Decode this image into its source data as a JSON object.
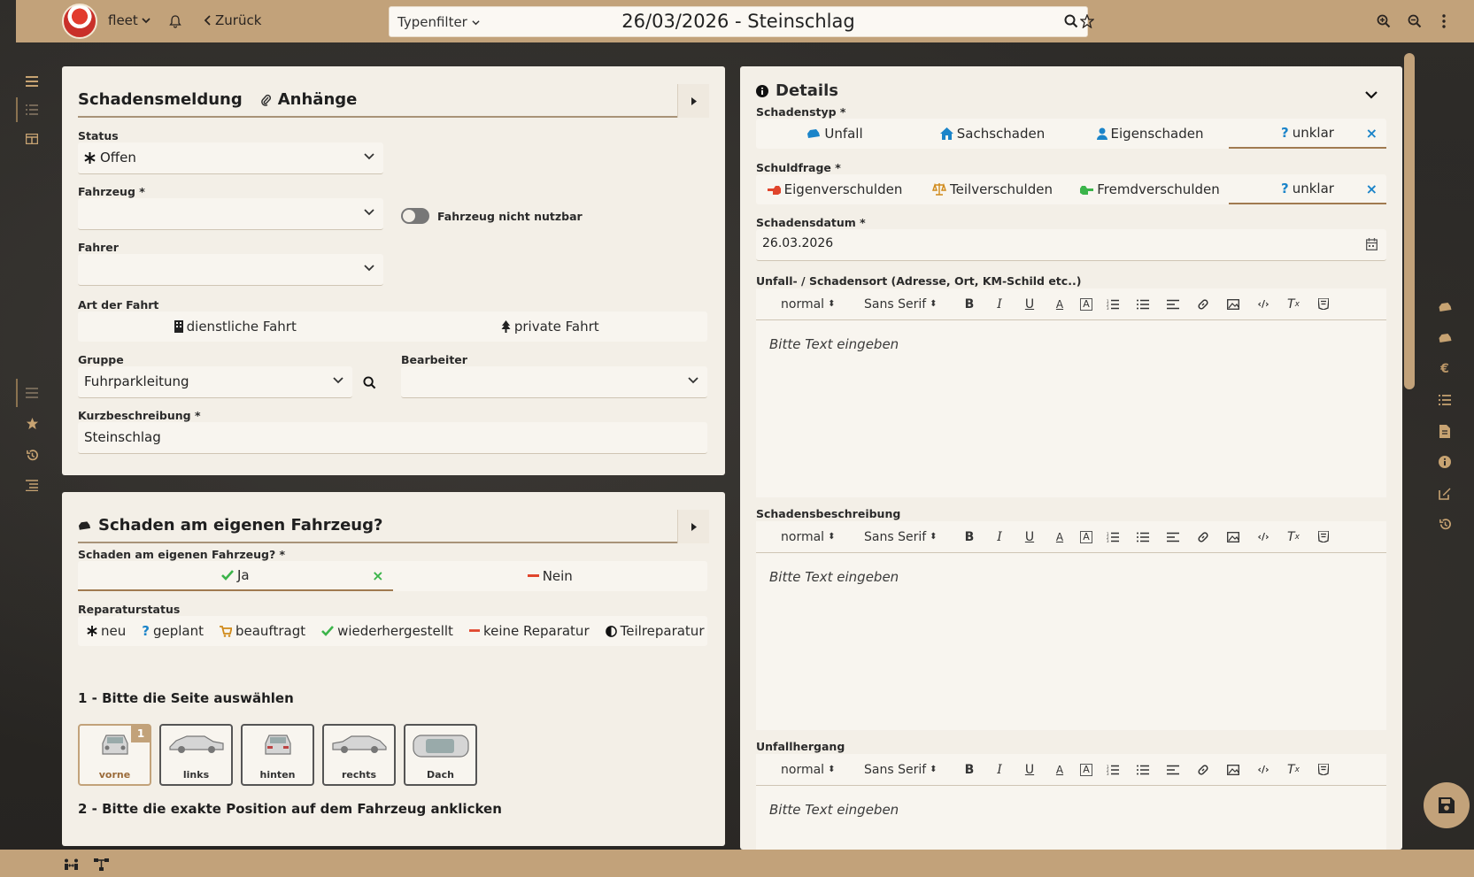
{
  "topbar": {
    "app_label": "fleet",
    "back_label": "Zurück",
    "filter_label": "Typenfilter",
    "record_title": "26/03/2026 - Steinschlag"
  },
  "card_damage": {
    "title": "Schadensmeldung",
    "attachments_label": "Anhänge",
    "status_label": "Status",
    "status_value": "Offen",
    "vehicle_label": "Fahrzeug *",
    "vehicle_value": "",
    "vehicle_unusable_label": "Fahrzeug nicht nutzbar",
    "driver_label": "Fahrer",
    "driver_value": "",
    "trip_type_label": "Art der Fahrt",
    "trip_types": [
      "dienstliche Fahrt",
      "private Fahrt"
    ],
    "group_label": "Gruppe",
    "group_value": "Fuhrparkleitung",
    "editor_label": "Bearbeiter",
    "editor_value": "",
    "short_desc_label": "Kurzbeschreibung *",
    "short_desc_value": "Steinschlag"
  },
  "card_own_vehicle": {
    "title": "Schaden am eigenen Fahrzeug?",
    "question_label": "Schaden am eigenen Fahrzeug? *",
    "yes_label": "Ja",
    "no_label": "Nein",
    "repair_status_label": "Reparaturstatus",
    "repair_status": [
      "neu",
      "geplant",
      "beauftragt",
      "wiederhergestellt",
      "keine Reparatur",
      "Teilreparatur"
    ],
    "step1_label": "1 - Bitte die Seite auswählen",
    "sides": [
      {
        "label": "vorne",
        "badge": "1"
      },
      {
        "label": "links",
        "badge": ""
      },
      {
        "label": "hinten",
        "badge": ""
      },
      {
        "label": "rechts",
        "badge": ""
      },
      {
        "label": "Dach",
        "badge": ""
      }
    ],
    "step2_label": "2 - Bitte die exakte Position auf dem Fahrzeug anklicken"
  },
  "card_details": {
    "title": "Details",
    "damage_type_label": "Schadenstyp *",
    "damage_types": [
      "Unfall",
      "Sachschaden",
      "Eigenschaden",
      "unklar"
    ],
    "fault_label": "Schuldfrage *",
    "fault_options": [
      "Eigenverschulden",
      "Teilverschulden",
      "Fremdverschulden",
      "unklar"
    ],
    "date_label": "Schadensdatum *",
    "date_value": "26.03.2026",
    "location_label": "Unfall- / Schadensort (Adresse, Ort, KM-Schild etc..)",
    "description_label": "Schadensbeschreibung",
    "course_label": "Unfallhergang",
    "editor_placeholder": "Bitte Text eingeben",
    "toolbar_size": "normal",
    "toolbar_font": "Sans Serif"
  },
  "colors": {
    "accent": "#c2a27a",
    "card_bg": "#f3efe7",
    "blue": "#1b84c9",
    "green": "#3bb44a",
    "red": "#e0452c"
  }
}
